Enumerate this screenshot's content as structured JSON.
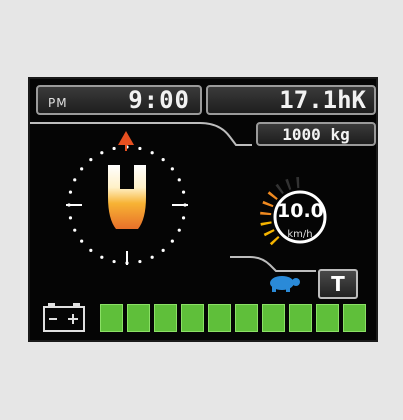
{
  "header": {
    "ampm": "PM",
    "time": "9:00",
    "hours": "17.1hK"
  },
  "load": {
    "weight": "1000 kg"
  },
  "speed": {
    "value": "10.0",
    "unit": "km/h",
    "level": 0.55
  },
  "mode": {
    "label": "T"
  },
  "battery": {
    "segments": 10,
    "filled": 10,
    "color": "#5fbf3a"
  },
  "colors": {
    "accent": "#f5b400",
    "fork": "#f0a020",
    "turtle": "#2a8ad8",
    "arrow": "#e85020"
  },
  "icons": [
    "battery-icon",
    "turtle-icon",
    "fork-icon",
    "direction-arrow-icon"
  ]
}
